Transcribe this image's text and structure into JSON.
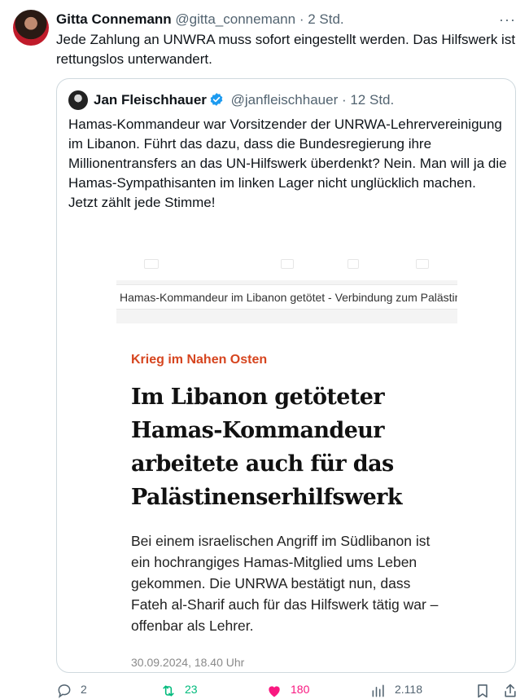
{
  "tweet": {
    "author_name": "Gitta Connemann",
    "handle": "@gitta_connemann",
    "time": "· 2 Std.",
    "more": "···",
    "text": "Jede Zahlung an UNWRA muss sofort eingestellt werden. Das Hilfswerk ist rettungslos unterwandert."
  },
  "quote": {
    "author_name": "Jan Fleischhauer",
    "handle": "@janfleischhauer",
    "time": "· 12 Std.",
    "text": "Hamas-Kommandeur war Vorsitzender der UNRWA-Lehrervereinigung im Libanon. Führt das dazu, dass die Bundesregierung ihre Millionentransfers an das UN-Hilfswerk überdenkt? Nein. Man will ja die Hamas-Sympathisanten im linken Lager nicht unglücklich machen. Jetzt zählt jede Stimme!"
  },
  "media": {
    "banner": "Hamas-Kommandeur im Libanon getötet - Verbindung zum Palästinenserhilfswerk",
    "kicker": "Krieg im Nahen Osten",
    "headline": "Im Libanon getöteter Hamas-Kommandeur arbeitete auch für das Palästinenserhilfswerk",
    "lead": "Bei einem israelischen Angriff im Südlibanon ist ein hochrangiges Hamas-Mitglied ums Leben gekommen. Die UNRWA bestätigt nun, dass Fateh al-Sharif auch für das Hilfswerk tätig war – offenbar als Lehrer.",
    "date": "30.09.2024, 18.40 Uhr"
  },
  "actions": {
    "replies": "2",
    "reposts": "23",
    "likes": "180",
    "views": "2.118"
  },
  "colors": {
    "kicker": "#d6451f",
    "verified": "#1d9bf0",
    "repost": "#00ba7c",
    "like": "#f91880"
  },
  "icons": [
    "more-icon",
    "verified-badge-icon",
    "reply-icon",
    "repost-icon",
    "like-icon",
    "views-icon",
    "bookmark-icon",
    "share-icon"
  ]
}
